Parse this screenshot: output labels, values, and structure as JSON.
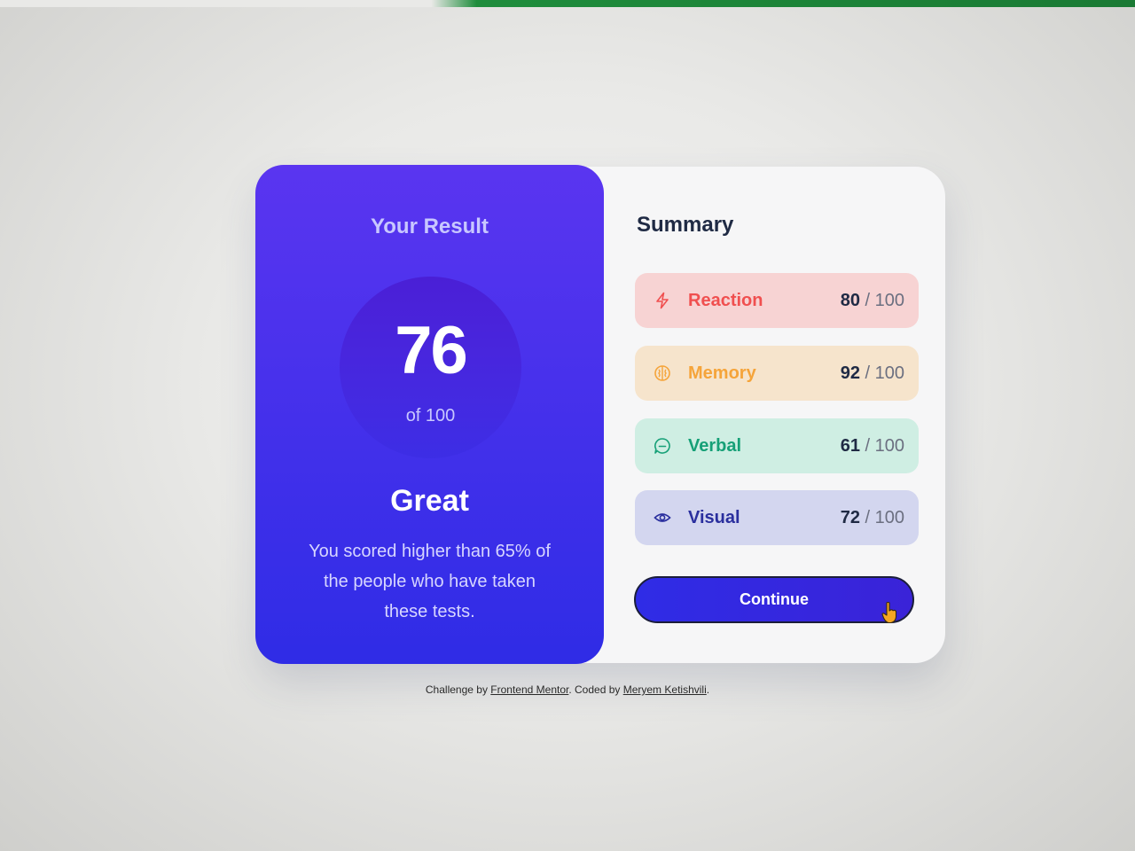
{
  "result": {
    "title": "Your Result",
    "score": "76",
    "score_of": "of 100",
    "grade": "Great",
    "message": "You scored higher than 65% of the people who have taken these tests.",
    "colors": {
      "gradient_top": "#5a35f0",
      "gradient_bottom": "#2f2ce6"
    }
  },
  "summary": {
    "title": "Summary",
    "items": [
      {
        "label": "Reaction",
        "score": "80",
        "max": " / 100",
        "icon": "lightning-icon",
        "color": "#f04f4f",
        "bg": "#f7d3d3"
      },
      {
        "label": "Memory",
        "score": "92",
        "max": " / 100",
        "icon": "brain-icon",
        "color": "#f5a43a",
        "bg": "#f6e4cc"
      },
      {
        "label": "Verbal",
        "score": "61",
        "max": " / 100",
        "icon": "chat-icon",
        "color": "#16a077",
        "bg": "#cfeee3"
      },
      {
        "label": "Visual",
        "score": "72",
        "max": " / 100",
        "icon": "eye-icon",
        "color": "#2a2f9e",
        "bg": "#d3d6ef"
      }
    ]
  },
  "actions": {
    "continue_label": "Continue"
  },
  "footer": {
    "prefix": "Challenge by ",
    "challenge_link": "Frontend Mentor",
    "middle": ". Coded by ",
    "author_link": "Meryem Ketishvili",
    "suffix": "."
  }
}
